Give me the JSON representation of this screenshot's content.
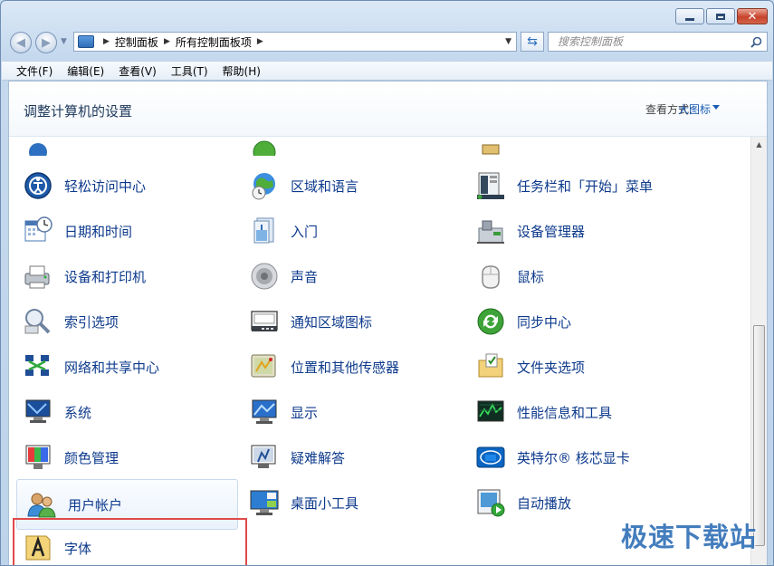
{
  "window": {
    "caption": {
      "minimize": "",
      "maximize": "",
      "close": "✕"
    }
  },
  "address": {
    "crumbs": [
      "控制面板",
      "所有控制面板项"
    ]
  },
  "search": {
    "placeholder": "搜索控制面板"
  },
  "menu": [
    "文件(F)",
    "编辑(E)",
    "查看(V)",
    "工具(T)",
    "帮助(H)"
  ],
  "header": {
    "title": "调整计算机的设置",
    "view_by_label": "查看方式:",
    "view_mode": "大图标"
  },
  "items": [
    {
      "label": "",
      "icon": "partial-icon-a"
    },
    {
      "label": "",
      "icon": "partial-icon-b"
    },
    {
      "label": "",
      "icon": "partial-icon-c"
    },
    {
      "label": "轻松访问中心",
      "icon": "ease-of-access-icon"
    },
    {
      "label": "区域和语言",
      "icon": "region-language-icon"
    },
    {
      "label": "任务栏和「开始」菜单",
      "icon": "taskbar-start-menu-icon"
    },
    {
      "label": "日期和时间",
      "icon": "date-time-icon"
    },
    {
      "label": "入门",
      "icon": "getting-started-icon"
    },
    {
      "label": "设备管理器",
      "icon": "device-manager-icon"
    },
    {
      "label": "设备和打印机",
      "icon": "devices-printers-icon"
    },
    {
      "label": "声音",
      "icon": "sound-icon"
    },
    {
      "label": "鼠标",
      "icon": "mouse-icon"
    },
    {
      "label": "索引选项",
      "icon": "indexing-options-icon"
    },
    {
      "label": "通知区域图标",
      "icon": "notification-area-icon"
    },
    {
      "label": "同步中心",
      "icon": "sync-center-icon"
    },
    {
      "label": "网络和共享中心",
      "icon": "network-sharing-icon"
    },
    {
      "label": "位置和其他传感器",
      "icon": "location-sensors-icon"
    },
    {
      "label": "文件夹选项",
      "icon": "folder-options-icon"
    },
    {
      "label": "系统",
      "icon": "system-icon"
    },
    {
      "label": "显示",
      "icon": "display-icon"
    },
    {
      "label": "性能信息和工具",
      "icon": "performance-icon"
    },
    {
      "label": "颜色管理",
      "icon": "color-management-icon"
    },
    {
      "label": "疑难解答",
      "icon": "troubleshooting-icon"
    },
    {
      "label": "英特尔® 核芯显卡",
      "icon": "intel-graphics-icon"
    },
    {
      "label": "用户帐户",
      "icon": "user-accounts-icon",
      "selected": true
    },
    {
      "label": "桌面小工具",
      "icon": "desktop-gadgets-icon"
    },
    {
      "label": "自动播放",
      "icon": "autoplay-icon"
    },
    {
      "label": "字体",
      "icon": "fonts-icon"
    }
  ],
  "watermark": "极速下载站",
  "colors": {
    "link": "#0d3a8c",
    "highlight_border": "#e04a4a",
    "watermark": "#2f6fb6"
  }
}
